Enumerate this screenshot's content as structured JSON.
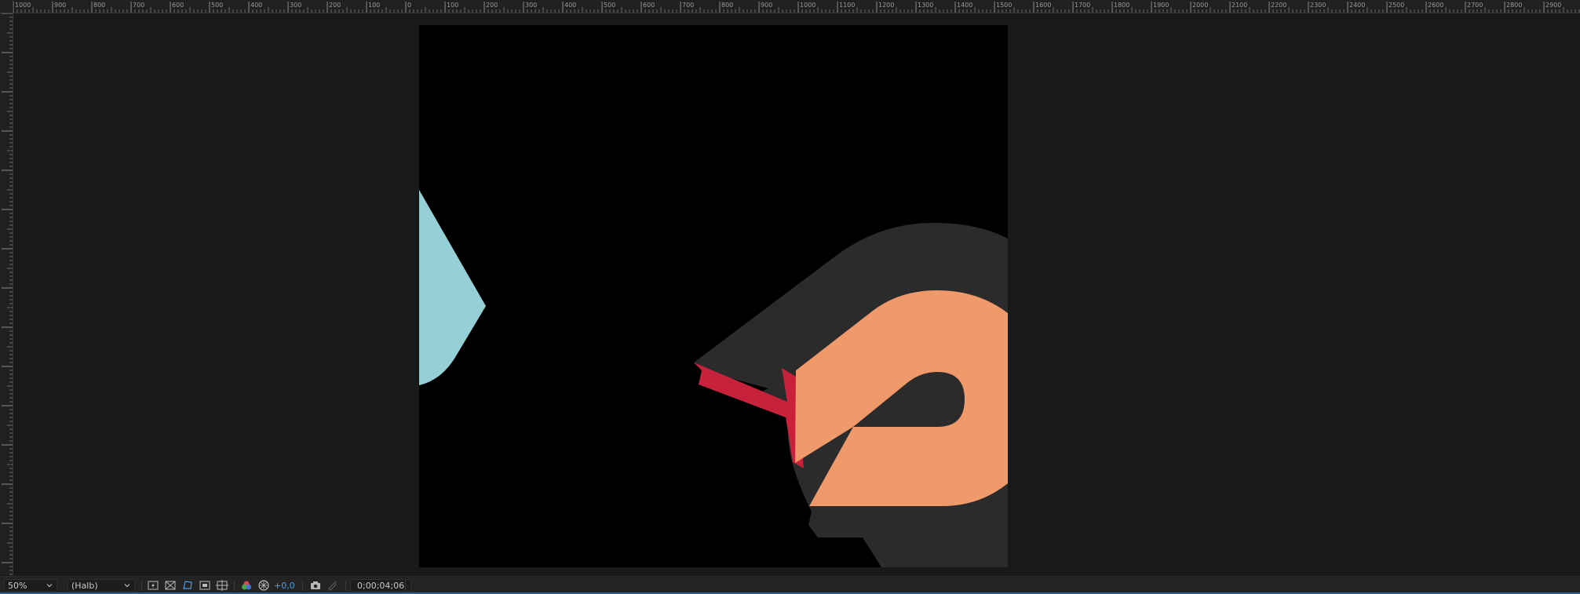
{
  "ruler": {
    "horizontal_labels": [
      "1000",
      "900",
      "800",
      "700",
      "600",
      "500",
      "400",
      "300",
      "200",
      "100",
      "0",
      "100",
      "200",
      "300",
      "400",
      "500",
      "600",
      "700",
      "800",
      "900",
      "1000",
      "1100",
      "1200",
      "1300",
      "1400",
      "1500",
      "1600",
      "1700",
      "1800",
      "1900",
      "2000",
      "2100",
      "2200",
      "2300",
      "2400",
      "2500",
      "2600",
      "2700",
      "2800",
      "2900"
    ]
  },
  "composition": {
    "background": "#000000",
    "shape_colors": {
      "blue_shape": "#96d0d6",
      "dark_extrusion": "#2b2b2b",
      "orange_face": "#f0996b",
      "red_edge": "#c8213c"
    }
  },
  "toolbar": {
    "zoom": "50%",
    "resolution": "(Halb)",
    "exposure": "+0,0",
    "timecode": "0;00;04;06",
    "icons": [
      "fast-previews-icon",
      "transparency-grid-icon",
      "mask-visibility-icon",
      "region-of-interest-icon",
      "guides-icon",
      "channel-icon",
      "exposure-reset-icon",
      "snapshot-icon",
      "show-snapshot-icon"
    ]
  },
  "colors": {
    "accent": "#4a9fe6",
    "panel": "#191919",
    "bar": "#232323"
  }
}
